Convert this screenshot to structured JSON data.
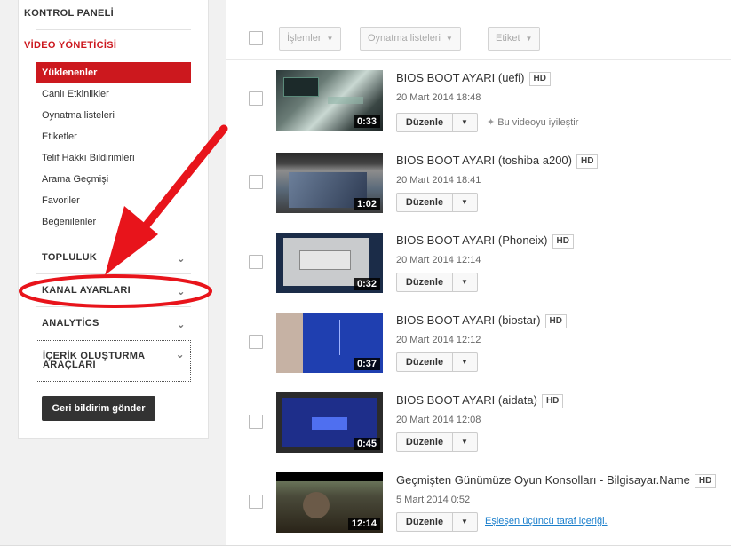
{
  "sidebar": {
    "dashboard": "KONTROL PANELİ",
    "video_manager": "VİDEO YÖNETİCİSİ",
    "items": [
      {
        "label": "Yüklenenler",
        "active": true
      },
      {
        "label": "Canlı Etkinlikler"
      },
      {
        "label": "Oynatma listeleri"
      },
      {
        "label": "Etiketler"
      },
      {
        "label": "Telif Hakkı Bildirimleri"
      },
      {
        "label": "Arama Geçmişi"
      },
      {
        "label": "Favoriler"
      },
      {
        "label": "Beğenilenler"
      }
    ],
    "community": "TOPLULUK",
    "channel_settings": "KANAL AYARLARI",
    "analytics": "ANALYTİCS",
    "creator_tools": "İÇERİK OLUŞTURMA ARAÇLARI",
    "feedback": "Geri bildirim gönder"
  },
  "toolbar": {
    "actions": "İşlemler",
    "playlists": "Oynatma listeleri",
    "tags": "Etiket"
  },
  "videos": [
    {
      "title": "BIOS BOOT AYARI (uefi)",
      "badge": "HD",
      "date": "20 Mart 2014 18:48",
      "duration": "0:33",
      "edit": "Düzenle",
      "extra": "Bu videoyu iyileştir"
    },
    {
      "title": "BIOS BOOT AYARI (toshiba a200)",
      "badge": "HD",
      "date": "20 Mart 2014 18:41",
      "duration": "1:02",
      "edit": "Düzenle"
    },
    {
      "title": "BIOS BOOT AYARI (Phoneix)",
      "badge": "HD",
      "date": "20 Mart 2014 12:14",
      "duration": "0:32",
      "edit": "Düzenle"
    },
    {
      "title": "BIOS BOOT AYARI (biostar)",
      "badge": "HD",
      "date": "20 Mart 2014 12:12",
      "duration": "0:37",
      "edit": "Düzenle"
    },
    {
      "title": "BIOS BOOT AYARI (aidata)",
      "badge": "HD",
      "date": "20 Mart 2014 12:08",
      "duration": "0:45",
      "edit": "Düzenle"
    },
    {
      "title": "Geçmişten Günümüze Oyun Konsolları - Bilgisayar.Name",
      "badge": "HD",
      "date": "5 Mart 2014 0:52",
      "duration": "12:14",
      "edit": "Düzenle",
      "link": "Eşleşen üçüncü taraf içeriği."
    }
  ],
  "colors": {
    "accent_red": "#cc181e",
    "annotation_red": "#e8141b",
    "link_blue": "#1b7fcc"
  }
}
